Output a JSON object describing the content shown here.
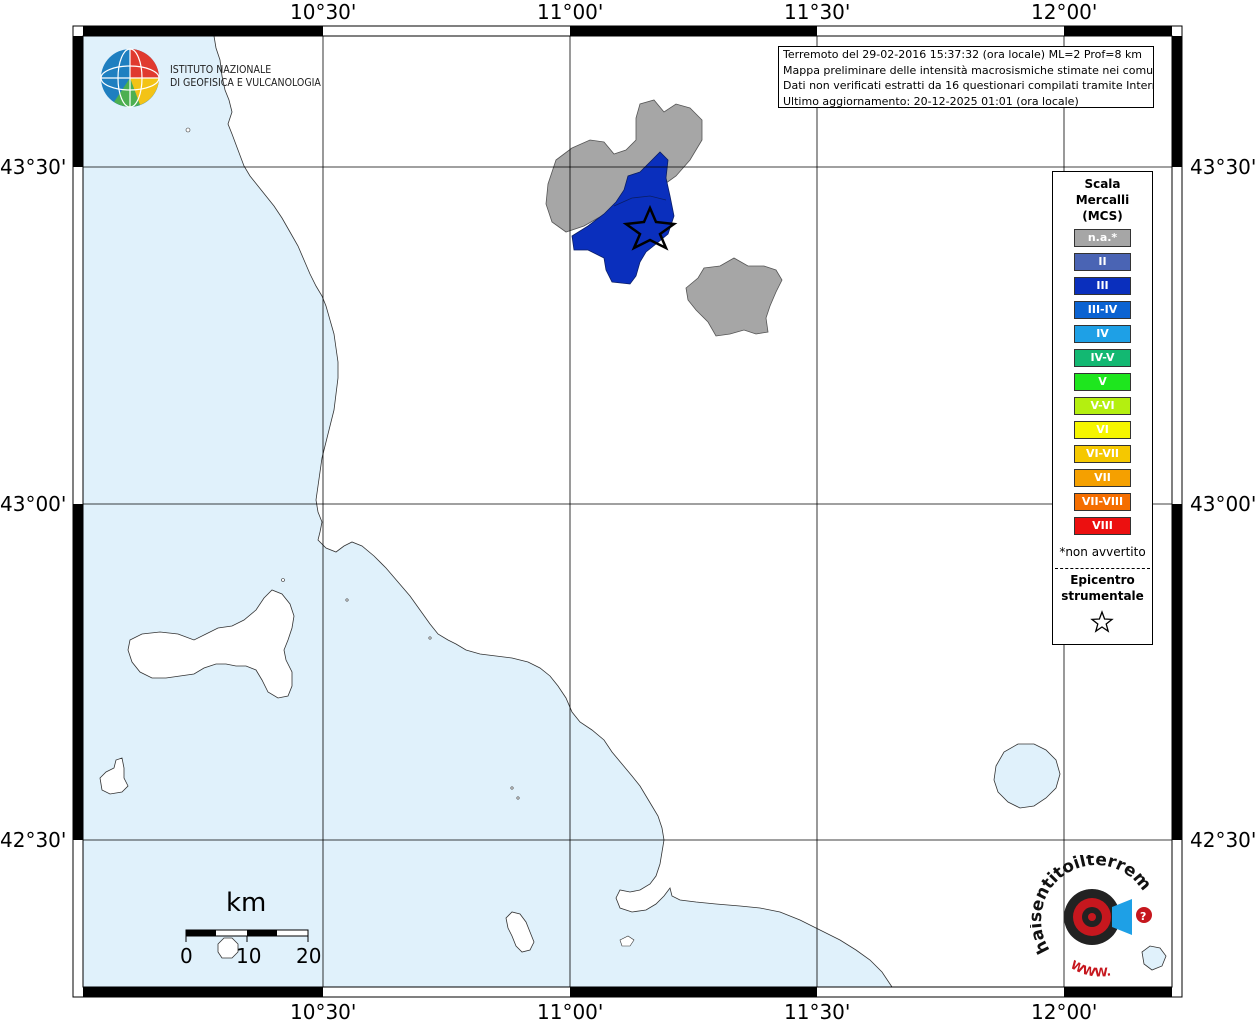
{
  "map": {
    "x_ticks": [
      "10°30'",
      "11°00'",
      "11°30'",
      "12°00'"
    ],
    "y_ticks": [
      "43°30'",
      "43°00'",
      "42°30'"
    ]
  },
  "info_box": {
    "lines": [
      "Terremoto del 29-02-2016 15:37:32 (ora locale) ML=2 Prof=8 km",
      "Mappa preliminare delle intensità macrosismiche stimate nei comuni",
      "Dati non verificati estratti da 16 questionari compilati tramite Internet.",
      "Ultimo aggiornamento: 20-12-2025 01:01 (ora locale)"
    ]
  },
  "logo_ingv": {
    "line1": "ISTITUTO NAZIONALE",
    "line2": "DI GEOFISICA E VULCANOLOGIA"
  },
  "legend": {
    "title_lines": [
      "Scala",
      "Mercalli",
      "(MCS)"
    ],
    "items": [
      {
        "label": "n.a.*",
        "color": "#a6a6a6"
      },
      {
        "label": "II",
        "color": "#4a64b4"
      },
      {
        "label": "III",
        "color": "#0a2fbd"
      },
      {
        "label": "III-IV",
        "color": "#0b63d2"
      },
      {
        "label": "IV",
        "color": "#1ea0e6"
      },
      {
        "label": "IV-V",
        "color": "#13b872"
      },
      {
        "label": "V",
        "color": "#1ee61e"
      },
      {
        "label": "V-VI",
        "color": "#b4ef10"
      },
      {
        "label": "VI",
        "color": "#f5f500"
      },
      {
        "label": "VI-VII",
        "color": "#f5c800"
      },
      {
        "label": "VII",
        "color": "#f5a000"
      },
      {
        "label": "VII-VIII",
        "color": "#f56e00"
      },
      {
        "label": "VIII",
        "color": "#ec1010"
      }
    ],
    "note": "*non avvertito",
    "epicenter_lines": [
      "Epicentro",
      "strumentale"
    ]
  },
  "scale_bar": {
    "title": "km",
    "labels": [
      "0",
      "10",
      "20"
    ]
  },
  "hsit_logo": {
    "text": "haisentitoilterremoto.it",
    "www": "WWW."
  },
  "colors": {
    "sea": "#e0f1fb",
    "intensity_na": "#a6a6a6",
    "intensity_III": "#0a2fbd"
  }
}
